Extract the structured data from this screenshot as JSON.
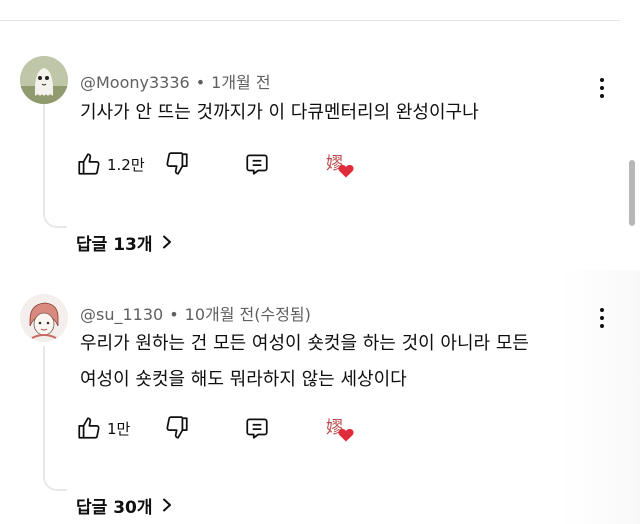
{
  "comments": [
    {
      "author": "@Moony3336",
      "time": "1개월 전",
      "text": "기사가 안 뜨는 것까지가 이 다큐멘터리의 완성이구나",
      "likes": "1.2만",
      "creator_heart_glyph": "嫪",
      "replies": "답글 13개"
    },
    {
      "author": "@su_1130",
      "time": "10개월 전(수정됨)",
      "text_line1": "우리가 원하는 건 모든 여성이 숏컷을 하는 것이 아니라 모든",
      "text_line2": "여성이 숏컷을 해도 뭐라하지 않는 세상이다",
      "likes": "1만",
      "creator_heart_glyph": "嫪",
      "replies": "답글 30개"
    }
  ],
  "icons": {
    "like": "thumbs-up-icon",
    "dislike": "thumbs-down-icon",
    "reply": "reply-comment-icon",
    "menu": "more-vertical-icon",
    "heart": "heart-icon",
    "expand": "chevron-right-icon"
  },
  "colors": {
    "text": "#0f0f0f",
    "meta": "#606060",
    "heart": "#e02b3a",
    "divider": "#e5e5e5"
  }
}
